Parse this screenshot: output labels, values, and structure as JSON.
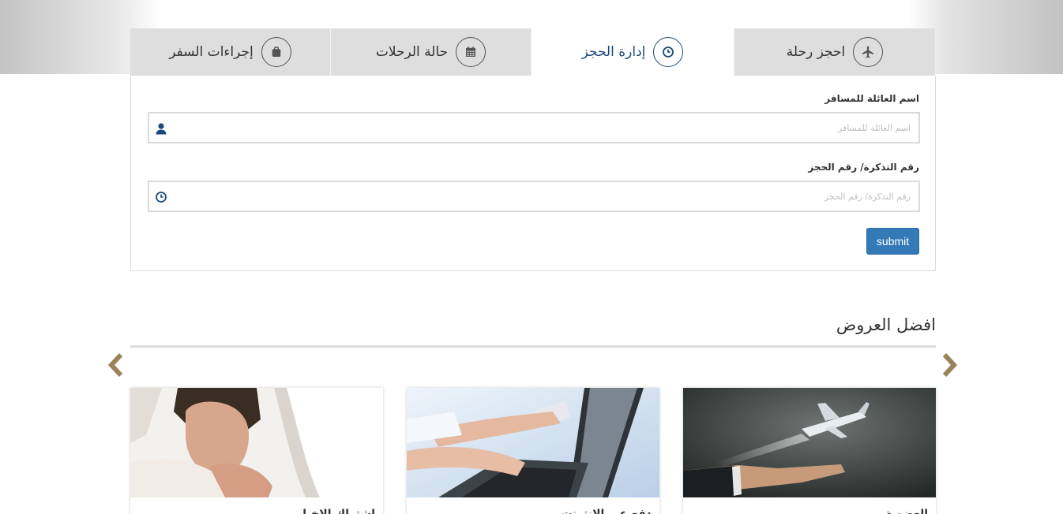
{
  "tabs": [
    {
      "label": "احجز رحلة",
      "icon": "plane-icon",
      "active": false
    },
    {
      "label": "إدارة الحجز",
      "icon": "clock-icon",
      "active": true
    },
    {
      "label": "حالة الرحلات",
      "icon": "calendar-icon",
      "active": false
    },
    {
      "label": "إجراءات السفر",
      "icon": "briefcase-icon",
      "active": false
    }
  ],
  "form": {
    "family_name": {
      "label": "اسم العائلة للمسافر",
      "placeholder": "اسم العائلة للمسافر",
      "value": "",
      "icon": "user-icon"
    },
    "ticket_number": {
      "label": "رقم التذكرة/ رقم الحجز",
      "placeholder": "رقم التذكرة/ رقم الحجز",
      "value": "",
      "icon": "clock-icon"
    },
    "submit_label": "submit"
  },
  "offers": {
    "title": "افضل العروض",
    "prev_icon": "chevron-left-icon",
    "next_icon": "chevron-right-icon",
    "cards": [
      {
        "title": "العضوية",
        "image": "hand-holding-airplane"
      },
      {
        "title": "دفع عبر الانترنت",
        "image": "hands-typing-laptop-credit-card"
      },
      {
        "title": "اشتراك الاخبار",
        "image": "man-by-airplane-window"
      }
    ]
  },
  "colors": {
    "accent": "#1b4a7a",
    "button": "#337ab7",
    "tab_bg": "#dedede",
    "arrow": "#9b8259"
  }
}
